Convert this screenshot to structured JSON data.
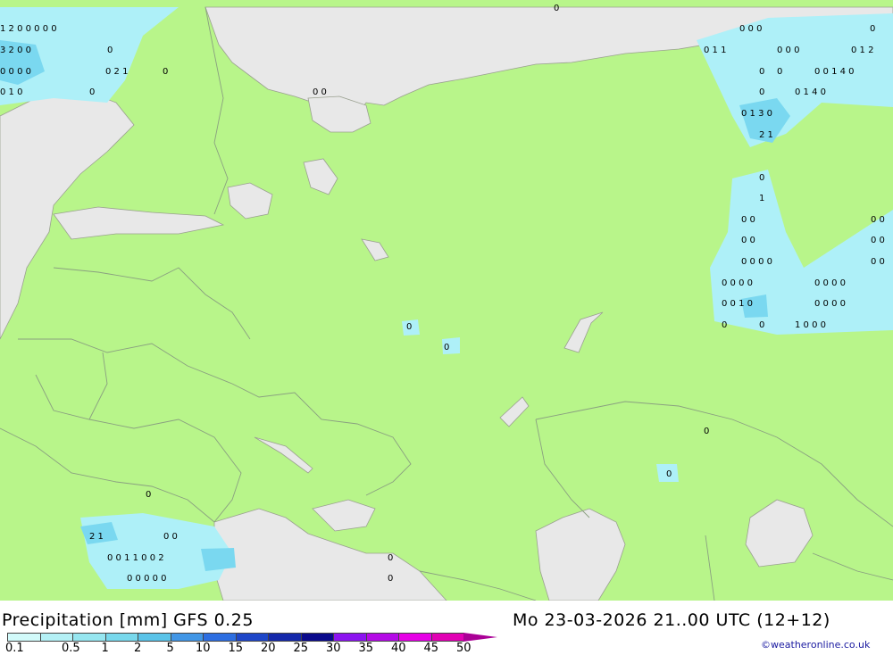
{
  "title": {
    "left": "Precipitation [mm] GFS 0.25",
    "right": "Mo 23-03-2026 21..00 UTC (12+12)"
  },
  "credit": "©weatheronline.co.uk",
  "colors": {
    "land": "#b8f58a",
    "water": "#e8e8e8",
    "border": "#8aa080",
    "precip_light": "#aef0f8",
    "precip_medium": "#7ad8f0",
    "precip_heavy": "#40b0e8"
  },
  "legend": {
    "ticks": [
      "0.1",
      "0.5",
      "1",
      "2",
      "5",
      "10",
      "15",
      "20",
      "25",
      "30",
      "35",
      "40",
      "45",
      "50"
    ],
    "colors": [
      "#d2fafa",
      "#b4f0f5",
      "#96e6f0",
      "#78d8ec",
      "#5ac3e8",
      "#4196e6",
      "#2d6ee1",
      "#1e46c8",
      "#1428aa",
      "#0a0a8c",
      "#8c14f0",
      "#b40ae6",
      "#e600e6",
      "#e100b4",
      "#aa0096"
    ]
  },
  "labels": {
    "nw1": "1 2 0 0 0 0 0",
    "nw2": "3 2 0 0",
    "nw3": "0",
    "nw4": "0 0 0 0",
    "nw5": "0 2 1",
    "nw6": "0",
    "nw7": "0 1 0",
    "nw8": "0",
    "top1": "0",
    "top2": "0 0",
    "ne1": "0 0 0",
    "ne2": "0",
    "ne3": "0 1 1",
    "ne4": "0 0 0",
    "ne5": "0 1 2",
    "ne6": "0",
    "ne7": "0",
    "ne8": "0 0 1 4 0",
    "ne9": "0",
    "ne10": "0 1 4 0",
    "ne11": "0 1 3 0",
    "ne12": "2 1",
    "e1": "0",
    "e2": "1",
    "e3": "0 0",
    "e4": "0 0",
    "e5": "0 0",
    "e6": "0 0",
    "e7": "0 0 0 0",
    "e8": "0 0",
    "e9": "0 0 0 0",
    "e10": "0 0 0 0",
    "e11": "0 0 1 0",
    "e12": "0 0 0 0",
    "e13": "0",
    "e14": "0",
    "e15": "1 0 0 0",
    "c1": "0",
    "c2": "0",
    "c3": "0",
    "c4": "0",
    "sw1": "0",
    "sw2": "2 1",
    "sw3": "0 0",
    "sw4": "0 0 1 1 0 0 2",
    "sw5": "0 0 0 0 0",
    "sw6": "0",
    "sw7": "0"
  }
}
